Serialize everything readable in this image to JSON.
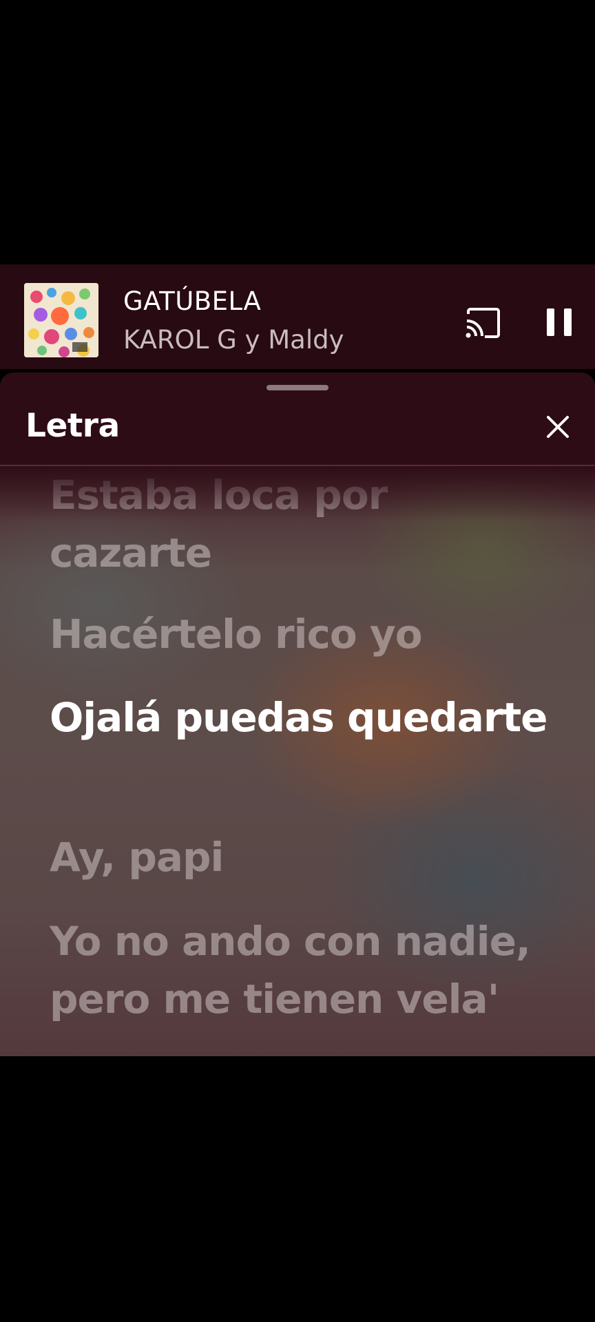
{
  "player": {
    "title": "GATÚBELA",
    "artist": "KAROL G y Maldy",
    "album_art_icon": "album-cover-image",
    "cast_icon": "cast-icon",
    "pause_icon": "pause-icon"
  },
  "lyrics_sheet": {
    "title": "Letra",
    "close_icon": "close-icon",
    "lines": [
      {
        "text": "Estaba loca por cazarte",
        "state": "past"
      },
      {
        "text": "Hacértelo rico yo",
        "state": "past"
      },
      {
        "text": "Ojalá puedas quedarte",
        "state": "current"
      },
      {
        "text": "Ay, papi",
        "state": "upcoming"
      },
      {
        "text": "Yo no ando con nadie, pero me tienen vela'",
        "state": "upcoming"
      }
    ]
  },
  "colors": {
    "background": "#000000",
    "player_bar": "#280a12",
    "sheet_header": "#2e0c16",
    "active_lyric": "#ffffff",
    "inactive_lyric": "#cdc3c3"
  }
}
